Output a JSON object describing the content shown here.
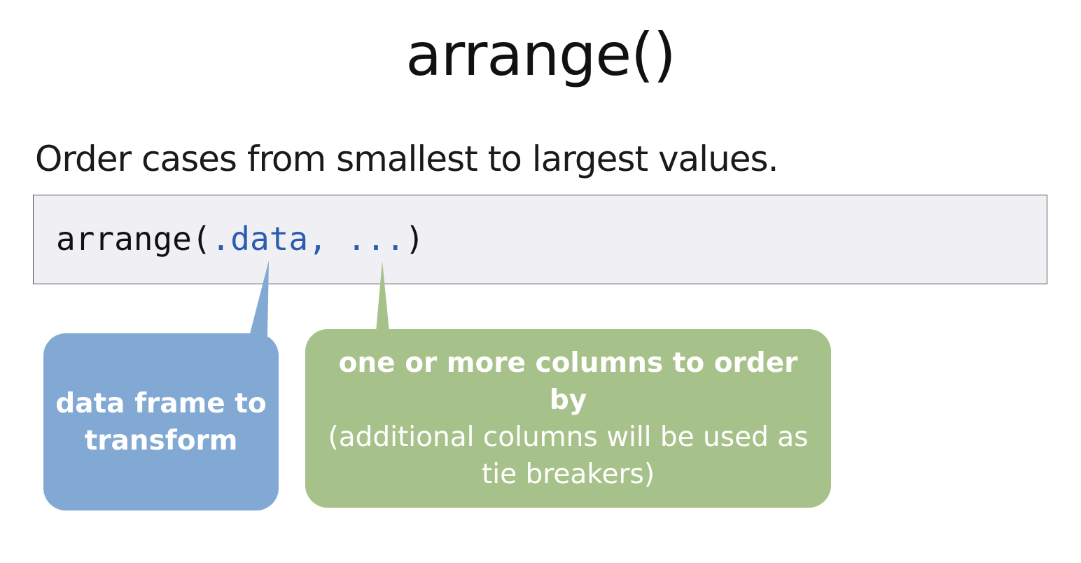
{
  "slide": {
    "title": "arrange()",
    "subtitle": "Order cases from smallest to largest values."
  },
  "code": {
    "fn_open": "arrange(",
    "arg_data": ".data",
    "sep": ", ",
    "arg_dots": "...",
    "close": ")"
  },
  "callouts": {
    "data": {
      "line1": "data frame to",
      "line2": "transform",
      "color": "#82a9d4"
    },
    "dots": {
      "bold_line": "one or more columns to order by",
      "line2": "(additional columns will be used as",
      "line3": "tie breakers)",
      "color": "#a7c18a"
    }
  },
  "colors": {
    "code_background": "#f0f0f4",
    "code_argument": "#2a5db0"
  }
}
